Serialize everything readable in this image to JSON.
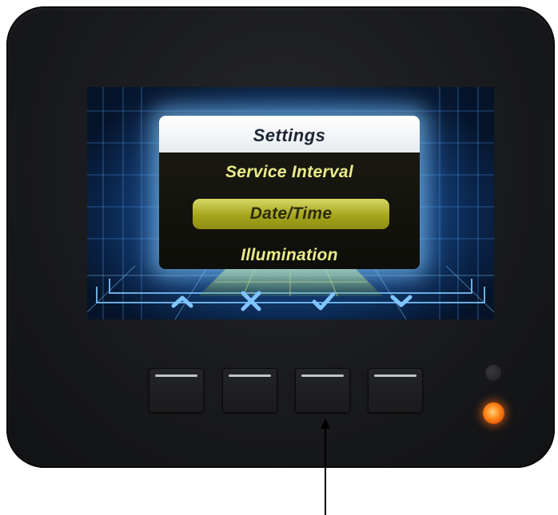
{
  "menu": {
    "title": "Settings",
    "items": [
      {
        "label": "Service Interval",
        "selected": false
      },
      {
        "label": "Date/Time",
        "selected": true
      },
      {
        "label": "Illumination",
        "selected": false
      }
    ]
  },
  "softkeys": [
    {
      "icon": "chevron-up-icon"
    },
    {
      "icon": "close-x-icon"
    },
    {
      "icon": "checkmark-icon"
    },
    {
      "icon": "chevron-down-icon"
    }
  ],
  "colors": {
    "menu_text": "#ecec8a",
    "selection_highlight": "#c9cb4f",
    "softkey_icon": "#7ec4ff",
    "status_led": "#ff7a14",
    "screen_glow": "#8cd2ff"
  },
  "indicators": {
    "upper_led": "off",
    "lower_led": "on"
  }
}
